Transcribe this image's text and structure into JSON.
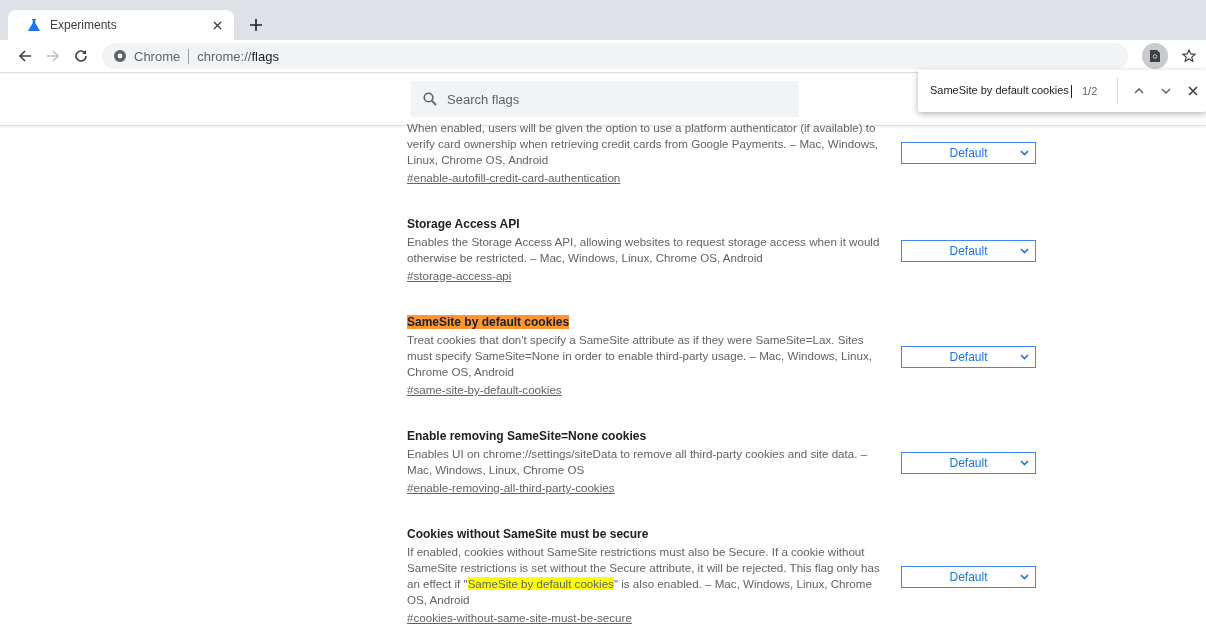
{
  "tabs": [
    {
      "title": "Experiments",
      "selected": true
    }
  ],
  "toolbar": {
    "site_label": "Chrome",
    "url_prefix": "chrome://",
    "url_path": "flags"
  },
  "search": {
    "placeholder": "Search flags"
  },
  "find_bar": {
    "query": "SameSite by default cookies",
    "count": "1/2"
  },
  "flags": [
    {
      "description": [
        {
          "text": "When enabled, users will be given the option to use a platform authenticator (if available) to verify card ownership when retrieving credit cards from Google Payments. – Mac, Windows, Linux, Chrome OS, Android",
          "highlighted": false
        }
      ],
      "link": "#enable-autofill-credit-card-authentication",
      "value": "Default"
    },
    {
      "title": "Storage Access API",
      "title_highlighted": false,
      "description": [
        {
          "text": "Enables the Storage Access API, allowing websites to request storage access when it would otherwise be restricted. – Mac, Windows, Linux, Chrome OS, Android",
          "highlighted": false
        }
      ],
      "link": "#storage-access-api",
      "value": "Default"
    },
    {
      "title": "SameSite by default cookies",
      "title_highlighted": true,
      "description": [
        {
          "text": "Treat cookies that don't specify a SameSite attribute as if they were SameSite=Lax. Sites must specify SameSite=None in order to enable third-party usage. – Mac, Windows, Linux, Chrome OS, Android",
          "highlighted": false
        }
      ],
      "link": "#same-site-by-default-cookies",
      "value": "Default"
    },
    {
      "title": "Enable removing SameSite=None cookies",
      "title_highlighted": false,
      "description": [
        {
          "text": "Enables UI on chrome://settings/siteData to remove all third-party cookies and site data. – Mac, Windows, Linux, Chrome OS",
          "highlighted": false
        }
      ],
      "link": "#enable-removing-all-third-party-cookies",
      "value": "Default"
    },
    {
      "title": "Cookies without SameSite must be secure",
      "title_highlighted": false,
      "description": [
        {
          "text": "If enabled, cookies without SameSite restrictions must also be Secure. If a cookie without SameSite restrictions is set without the Secure attribute, it will be rejected. This flag only has an effect if \"",
          "highlighted": false
        },
        {
          "text": "SameSite by default cookies",
          "highlighted": true
        },
        {
          "text": "\" is also enabled. – Mac, Windows, Linux, Chrome OS, Android",
          "highlighted": false
        }
      ],
      "link": "#cookies-without-same-site-must-be-secure",
      "value": "Default"
    }
  ]
}
